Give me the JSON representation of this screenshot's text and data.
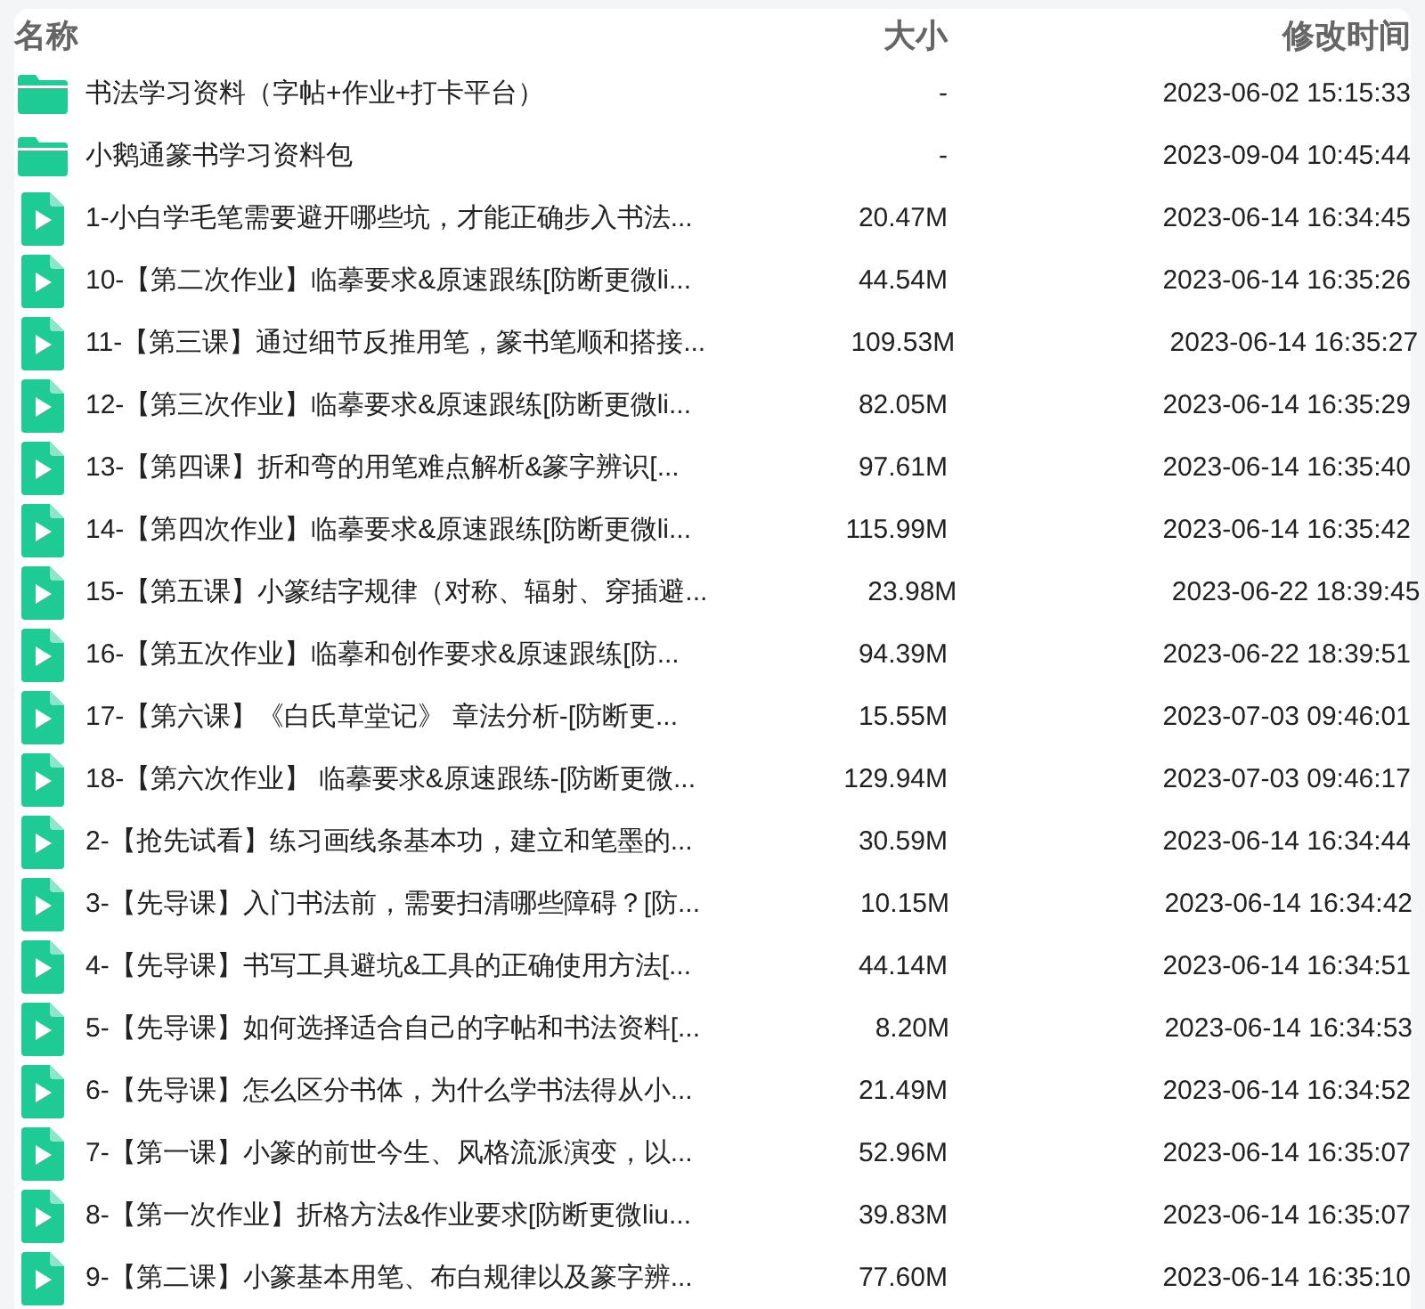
{
  "columns": [
    "名称",
    "大小",
    "修改时间"
  ],
  "rows": [
    {
      "kind": "folder",
      "name": "书法学习资料（字帖+作业+打卡平台）",
      "size": "-",
      "modified": "2023-06-02 15:15:33"
    },
    {
      "kind": "folder",
      "name": "小鹅通篆书学习资料包",
      "size": "-",
      "modified": "2023-09-04 10:45:44"
    },
    {
      "kind": "video",
      "name": "1-小白学毛笔需要避开哪些坑，才能正确步入书法...",
      "size": "20.47M",
      "modified": "2023-06-14 16:34:45"
    },
    {
      "kind": "video",
      "name": "10-【第二次作业】临摹要求&原速跟练[防断更微li...",
      "size": "44.54M",
      "modified": "2023-06-14 16:35:26"
    },
    {
      "kind": "video",
      "name": "11-【第三课】通过细节反推用笔，篆书笔顺和搭接...",
      "size": "109.53M",
      "modified": "2023-06-14 16:35:27"
    },
    {
      "kind": "video",
      "name": "12-【第三次作业】临摹要求&原速跟练[防断更微li...",
      "size": "82.05M",
      "modified": "2023-06-14 16:35:29"
    },
    {
      "kind": "video",
      "name": "13-【第四课】折和弯的用笔难点解析&篆字辨识[...",
      "size": "97.61M",
      "modified": "2023-06-14 16:35:40"
    },
    {
      "kind": "video",
      "name": "14-【第四次作业】临摹要求&原速跟练[防断更微li...",
      "size": "115.99M",
      "modified": "2023-06-14 16:35:42"
    },
    {
      "kind": "video",
      "name": "15-【第五课】小篆结字规律（对称、辐射、穿插避...",
      "size": "23.98M",
      "modified": "2023-06-22 18:39:45"
    },
    {
      "kind": "video",
      "name": "16-【第五次作业】临摹和创作要求&原速跟练[防...",
      "size": "94.39M",
      "modified": "2023-06-22 18:39:51"
    },
    {
      "kind": "video",
      "name": "17-【第六课】《白氏草堂记》 章法分析-[防断更...",
      "size": "15.55M",
      "modified": "2023-07-03 09:46:01"
    },
    {
      "kind": "video",
      "name": "18-【第六次作业】 临摹要求&原速跟练-[防断更微...",
      "size": "129.94M",
      "modified": "2023-07-03 09:46:17"
    },
    {
      "kind": "video",
      "name": "2-【抢先试看】练习画线条基本功，建立和笔墨的...",
      "size": "30.59M",
      "modified": "2023-06-14 16:34:44"
    },
    {
      "kind": "video",
      "name": "3-【先导课】入门书法前，需要扫清哪些障碍？[防...",
      "size": "10.15M",
      "modified": "2023-06-14 16:34:42"
    },
    {
      "kind": "video",
      "name": "4-【先导课】书写工具避坑&工具的正确使用方法[...",
      "size": "44.14M",
      "modified": "2023-06-14 16:34:51"
    },
    {
      "kind": "video",
      "name": "5-【先导课】如何选择适合自己的字帖和书法资料[...",
      "size": "8.20M",
      "modified": "2023-06-14 16:34:53"
    },
    {
      "kind": "video",
      "name": "6-【先导课】怎么区分书体，为什么学书法得从小...",
      "size": "21.49M",
      "modified": "2023-06-14 16:34:52"
    },
    {
      "kind": "video",
      "name": "7-【第一课】小篆的前世今生、风格流派演变，以...",
      "size": "52.96M",
      "modified": "2023-06-14 16:35:07"
    },
    {
      "kind": "video",
      "name": "8-【第一次作业】折格方法&作业要求[防断更微liu...",
      "size": "39.83M",
      "modified": "2023-06-14 16:35:07"
    },
    {
      "kind": "video",
      "name": "9-【第二课】小篆基本用笔、布白规律以及篆字辨...",
      "size": "77.60M",
      "modified": "2023-06-14 16:35:10"
    }
  ]
}
